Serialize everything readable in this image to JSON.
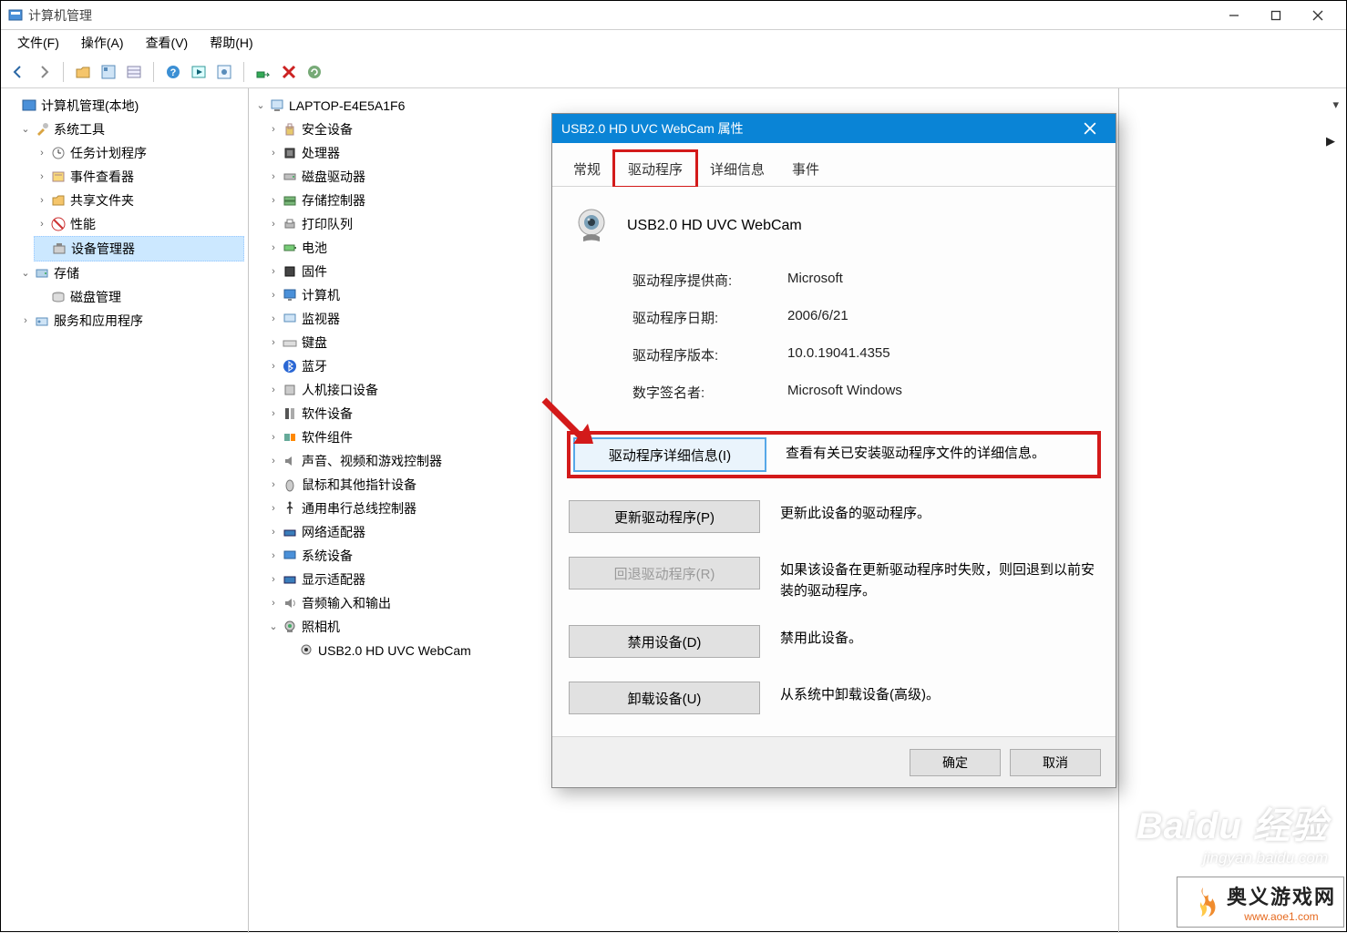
{
  "window": {
    "title": "计算机管理",
    "menu": {
      "file": "文件(F)",
      "action": "操作(A)",
      "view": "查看(V)",
      "help": "帮助(H)"
    }
  },
  "left_tree": {
    "root": "计算机管理(本地)",
    "system_tools": "系统工具",
    "task_scheduler": "任务计划程序",
    "event_viewer": "事件查看器",
    "shared_folders": "共享文件夹",
    "performance": "性能",
    "device_manager": "设备管理器",
    "storage": "存储",
    "disk_mgmt": "磁盘管理",
    "services_apps": "服务和应用程序"
  },
  "dev_tree": {
    "root": "LAPTOP-E4E5A1F6",
    "security_devices": "安全设备",
    "processors": "处理器",
    "disk_drives": "磁盘驱动器",
    "storage_controllers": "存储控制器",
    "print_queues": "打印队列",
    "batteries": "电池",
    "firmware": "固件",
    "computer": "计算机",
    "monitors": "监视器",
    "keyboards": "键盘",
    "bluetooth": "蓝牙",
    "hid": "人机接口设备",
    "software_devices": "软件设备",
    "software_components": "软件组件",
    "sound_video_game": "声音、视频和游戏控制器",
    "mice": "鼠标和其他指针设备",
    "usb_controllers": "通用串行总线控制器",
    "network_adapters": "网络适配器",
    "system_devices": "系统设备",
    "display_adapters": "显示适配器",
    "audio_io": "音频输入和输出",
    "cameras": "照相机",
    "webcam_item": "USB2.0 HD UVC WebCam"
  },
  "dialog": {
    "title": "USB2.0 HD UVC WebCam 属性",
    "tabs": {
      "general": "常规",
      "driver": "驱动程序",
      "details": "详细信息",
      "events": "事件"
    },
    "device_name": "USB2.0 HD UVC WebCam",
    "rows": {
      "provider_label": "驱动程序提供商:",
      "provider_value": "Microsoft",
      "date_label": "驱动程序日期:",
      "date_value": "2006/6/21",
      "version_label": "驱动程序版本:",
      "version_value": "10.0.19041.4355",
      "signer_label": "数字签名者:",
      "signer_value": "Microsoft Windows"
    },
    "buttons": {
      "details": "驱动程序详细信息(I)",
      "details_desc": "查看有关已安装驱动程序文件的详细信息。",
      "update": "更新驱动程序(P)",
      "update_desc": "更新此设备的驱动程序。",
      "rollback": "回退驱动程序(R)",
      "rollback_desc": "如果该设备在更新驱动程序时失败，则回退到以前安装的驱动程序。",
      "disable": "禁用设备(D)",
      "disable_desc": "禁用此设备。",
      "uninstall": "卸载设备(U)",
      "uninstall_desc": "从系统中卸载设备(高级)。",
      "ok": "确定",
      "cancel": "取消"
    }
  },
  "watermark": {
    "brand": "Baidu",
    "sub_cn": "经验",
    "sub_py": "jingyan.baidu.com"
  },
  "site_badge": {
    "cn": "奥义游戏网",
    "url": "www.aoe1.com"
  }
}
